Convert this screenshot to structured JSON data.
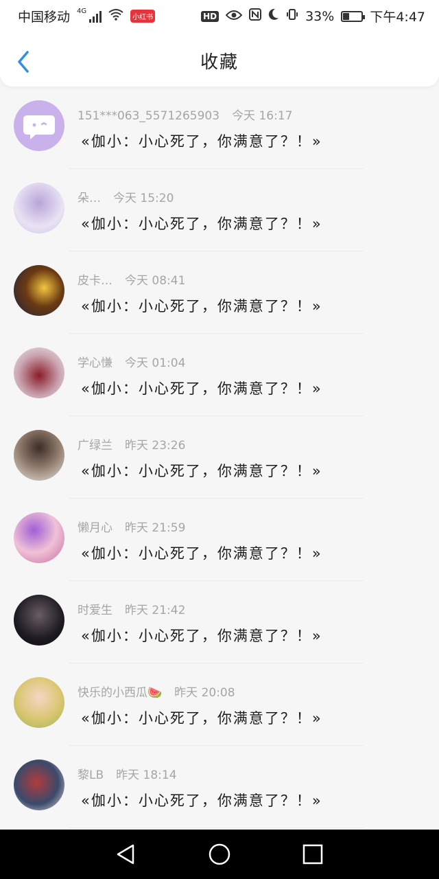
{
  "status_bar": {
    "carrier": "中国移动",
    "network": "4G",
    "app_badge": "小红书",
    "hd": "HD",
    "battery_percent": "33%",
    "battery_level": 0.33,
    "time": "下午4:47"
  },
  "header": {
    "title": "收藏",
    "back_icon": "chevron-left-icon"
  },
  "favorites": [
    {
      "name": "151***063_5571265903",
      "time": "今天 16:17",
      "message": "«伽小：小心死了，你满意了？！»"
    },
    {
      "name": "朵…",
      "time": "今天 15:20",
      "message": "«伽小：小心死了，你满意了？！»"
    },
    {
      "name": "皮卡…",
      "time": "今天 08:41",
      "message": "«伽小：小心死了，你满意了？！»"
    },
    {
      "name": "学心慊",
      "time": "今天 01:04",
      "message": "«伽小：小心死了，你满意了？！»"
    },
    {
      "name": "广绿兰",
      "time": "昨天 23:26",
      "message": "«伽小：小心死了，你满意了？！»"
    },
    {
      "name": "懒月心",
      "time": "昨天 21:59",
      "message": "«伽小：小心死了，你满意了？！»"
    },
    {
      "name": "时爱生",
      "time": "昨天 21:42",
      "message": "«伽小：小心死了，你满意了？！»"
    },
    {
      "name": "快乐的小西瓜🍉",
      "time": "昨天 20:08",
      "message": "«伽小：小心死了，你满意了？！»"
    },
    {
      "name": "黎LB",
      "time": "昨天 18:14",
      "message": "«伽小：小心死了，你满意了？！»"
    }
  ],
  "nav": {
    "back_icon": "triangle-back-icon",
    "home_icon": "circle-home-icon",
    "recents_icon": "square-recents-icon"
  },
  "colors": {
    "accent": "#2f8fe0",
    "meta_text": "#a5a5a5",
    "default_avatar": "#c9b1ec"
  }
}
